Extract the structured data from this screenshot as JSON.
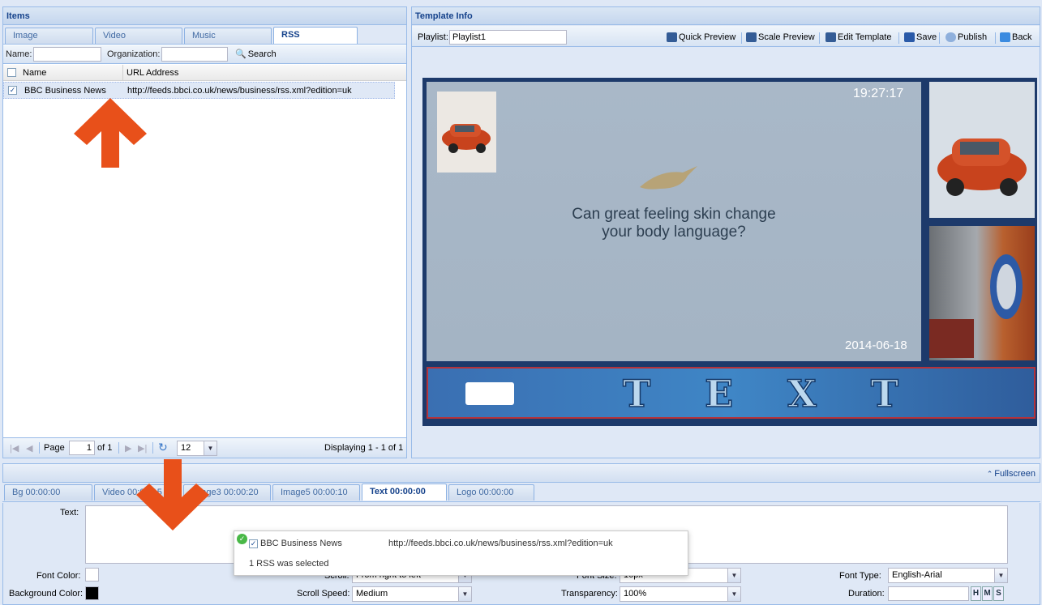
{
  "items_panel": {
    "title": "Items",
    "tabs": [
      "Image",
      "Video",
      "Music",
      "RSS"
    ],
    "filter": {
      "name_label": "Name:",
      "org_label": "Organization:",
      "search_label": "Search",
      "name_value": "",
      "org_value": ""
    },
    "columns": [
      "Name",
      "URL Address"
    ],
    "rows": [
      {
        "name": "BBC Business News",
        "url": "http://feeds.bbci.co.uk/news/business/rss.xml?edition=uk",
        "checked": true
      }
    ],
    "pager": {
      "page_label": "Page",
      "page_value": "1",
      "of_label": "of 1",
      "page_size": "12",
      "displaying": "Displaying 1 - 1 of 1"
    }
  },
  "template_panel": {
    "title": "Template Info",
    "playlist_label": "Playlist:",
    "playlist_value": "Playlist1",
    "toolbar": [
      "Quick Preview",
      "Scale Preview",
      "Edit Template",
      "Save",
      "Publish",
      "Back"
    ],
    "preview": {
      "time": "19:27:17",
      "date": "2014-06-18",
      "headline_line1": "Can great feeling skin change",
      "headline_line2": "your body language?",
      "ticker_text": "TEXT",
      "ticker_letters": [
        "T",
        "E",
        "X",
        "T"
      ]
    }
  },
  "bottom": {
    "fullscreen_label": "Fullscreen",
    "tabs": [
      "Bg  00:00:00",
      "Video 00:00:15",
      "Image3 00:00:20",
      "Image5 00:00:10",
      "Text 00:00:00",
      "Logo 00:00:00"
    ],
    "active_tab": 4,
    "form": {
      "text_label": "Text:",
      "font_color_label": "Font Color:",
      "bg_color_label": "Background Color:",
      "scroll_label": "Scroll:",
      "scroll_value": "From right to left",
      "scroll_speed_label": "Scroll Speed:",
      "scroll_speed_value": "Medium",
      "font_size_label": "Font Size:",
      "font_size_value": "16px",
      "transparency_label": "Transparency:",
      "transparency_value": "100%",
      "font_type_label": "Font Type:",
      "font_type_value": "English-Arial",
      "duration_label": "Duration:",
      "duration_value": "",
      "hms": [
        "H",
        "M",
        "S"
      ]
    }
  },
  "popup": {
    "name": "BBC Business News",
    "url": "http://feeds.bbci.co.uk/news/business/rss.xml?edition=uk",
    "message": "1 RSS was selected"
  },
  "colors": {
    "accent": "#15428b",
    "arrow": "#e8501a",
    "preview_bg": "#1d3a6b",
    "screen": "#a7b7c7",
    "ticker": "#3f80c0"
  }
}
